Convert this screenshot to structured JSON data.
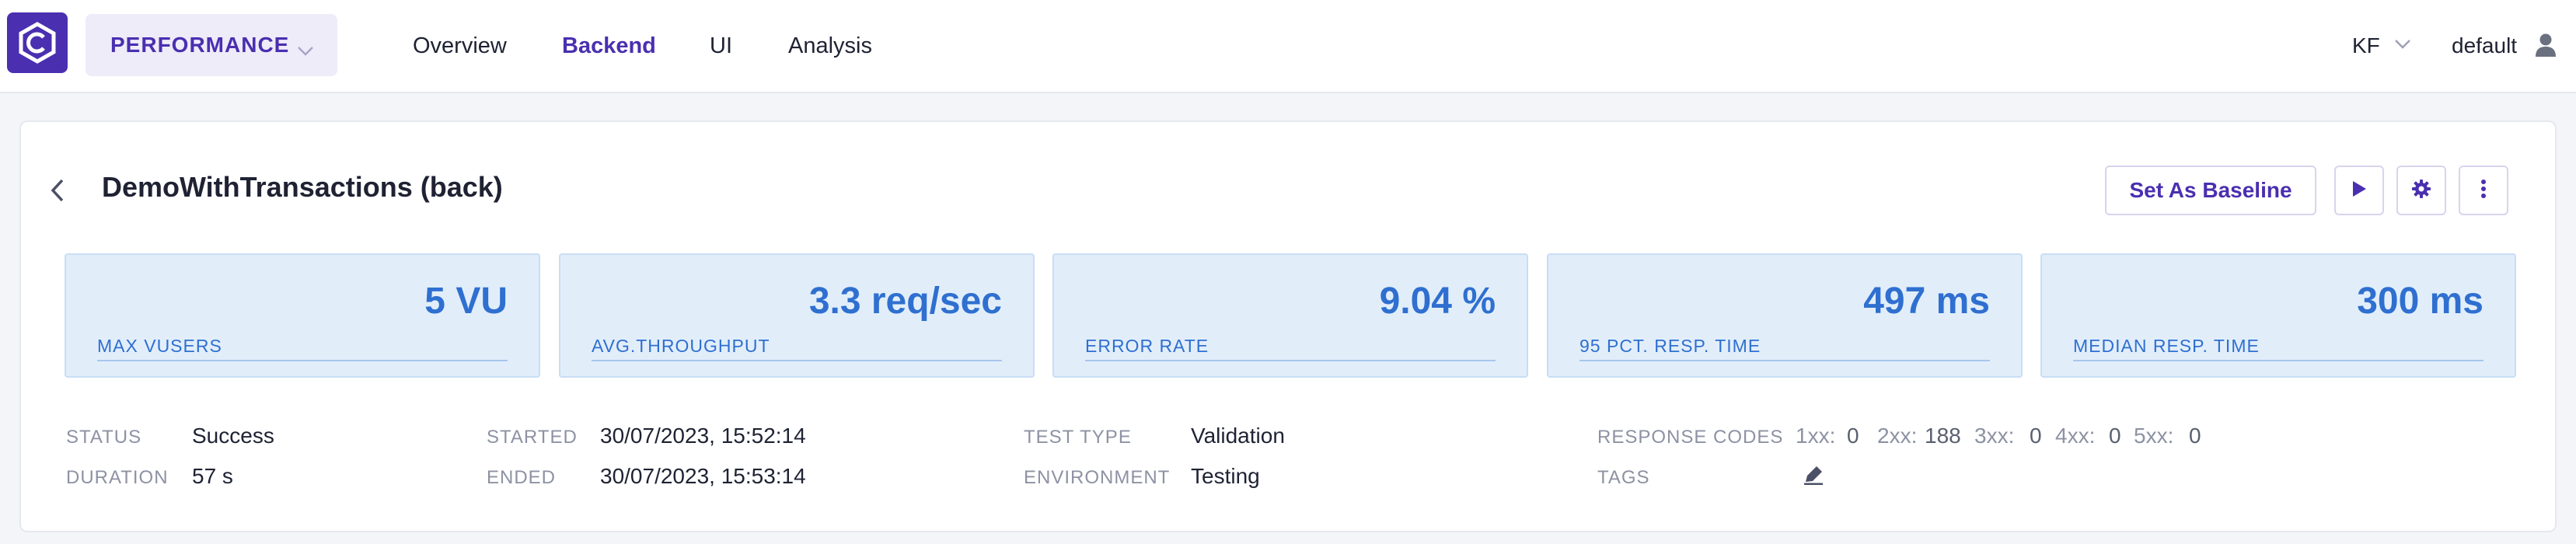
{
  "nav": {
    "project_label": "PERFORMANCE",
    "tabs": [
      {
        "label": "Overview",
        "active": false
      },
      {
        "label": "Backend",
        "active": true
      },
      {
        "label": "UI",
        "active": false
      },
      {
        "label": "Analysis",
        "active": false
      }
    ],
    "user_initials": "KF",
    "username": "default"
  },
  "report": {
    "title": "DemoWithTransactions (back)",
    "baseline_button": "Set As Baseline"
  },
  "kpis": [
    {
      "value": "5 VU",
      "label": "MAX VUSERS"
    },
    {
      "value": "3.3 req/sec",
      "label": "AVG.THROUGHPUT"
    },
    {
      "value": "9.04 %",
      "label": "ERROR RATE"
    },
    {
      "value": "497 ms",
      "label": "95 PCT. RESP. TIME"
    },
    {
      "value": "300 ms",
      "label": "MEDIAN RESP. TIME"
    }
  ],
  "details": {
    "status_label": "STATUS",
    "status_value": "Success",
    "duration_label": "DURATION",
    "duration_value": "57 s",
    "started_label": "STARTED",
    "started_value": "30/07/2023, 15:52:14",
    "ended_label": "ENDED",
    "ended_value": "30/07/2023, 15:53:14",
    "test_type_label": "TEST TYPE",
    "test_type_value": "Validation",
    "environment_label": "ENVIRONMENT",
    "environment_value": "Testing",
    "response_codes_label": "RESPONSE CODES",
    "tags_label": "TAGS",
    "response_codes": [
      {
        "code": "1xx:",
        "count": "0"
      },
      {
        "code": "2xx:",
        "count": "188"
      },
      {
        "code": "3xx:",
        "count": "0"
      },
      {
        "code": "4xx:",
        "count": "0"
      },
      {
        "code": "5xx:",
        "count": "0"
      }
    ]
  },
  "colors": {
    "brand": "#4a2fb0",
    "kpi_background": "#e1eefa",
    "kpi_text": "#2f6fd0"
  },
  "icons": [
    "app-logo-icon",
    "chevron-down-icon",
    "user-icon",
    "chevron-left-icon",
    "play-icon",
    "gear-icon",
    "more-vertical-icon",
    "pencil-icon"
  ]
}
